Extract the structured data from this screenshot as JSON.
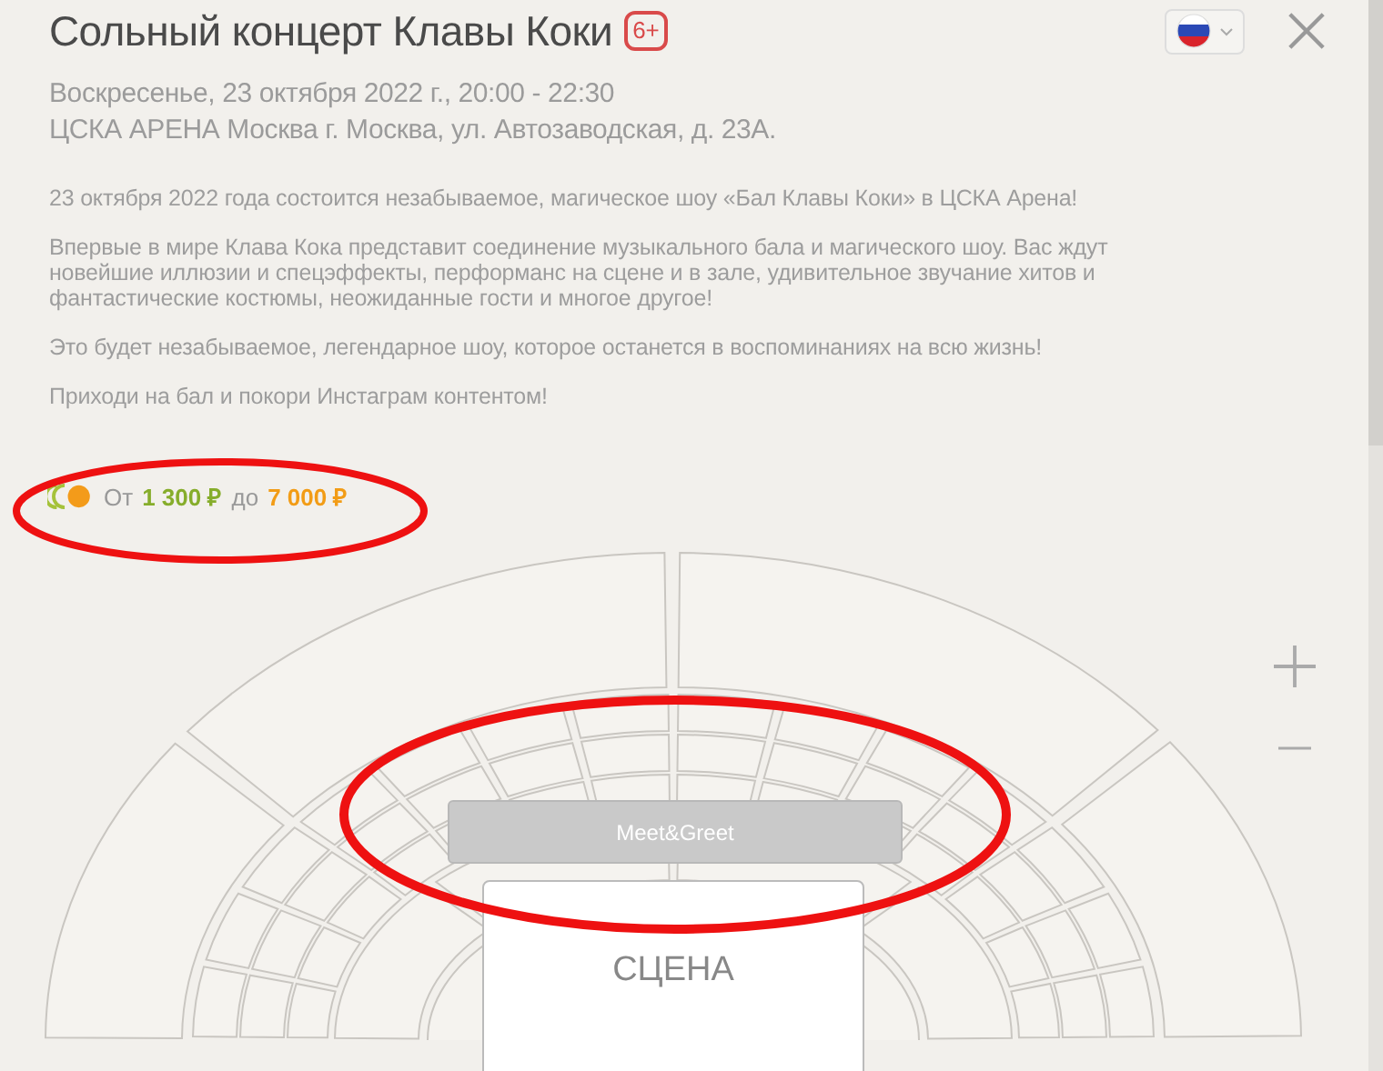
{
  "header": {
    "title": "Сольный концерт Клавы Коки",
    "age_badge": "6+"
  },
  "event": {
    "date": "Воскресенье, 23 октября 2022 г., 20:00 - 22:30",
    "venue": "ЦСКА АРЕНА Москва г. Москва, ул. Автозаводская, д. 23А."
  },
  "description": [
    "23 октября 2022 года состоится незабываемое, магическое шоу «Бал Клавы Коки» в ЦСКА Арена!",
    "Впервые в мире Клава Кока представит соединение музыкального бала и магического шоу. Вас ждут новейшие иллюзии и спецэффекты, перформанс на сцене и в зале, удивительное звучание хитов и фантастические костюмы, неожиданные гости и многое другое!",
    "Это будет незабываемое, легендарное шоу, которое останется в воспоминаниях на всю жизнь!",
    "Приходи на бал и покори Инстаграм контентом!"
  ],
  "price": {
    "from_label": "От",
    "min": "1 300 ₽",
    "to_label": "до",
    "max": "7 000 ₽"
  },
  "seat_map": {
    "zones": [
      {
        "kind": "block",
        "label": "Meet&Greet"
      },
      {
        "kind": "stage",
        "label": "СЦЕНА"
      }
    ]
  }
}
